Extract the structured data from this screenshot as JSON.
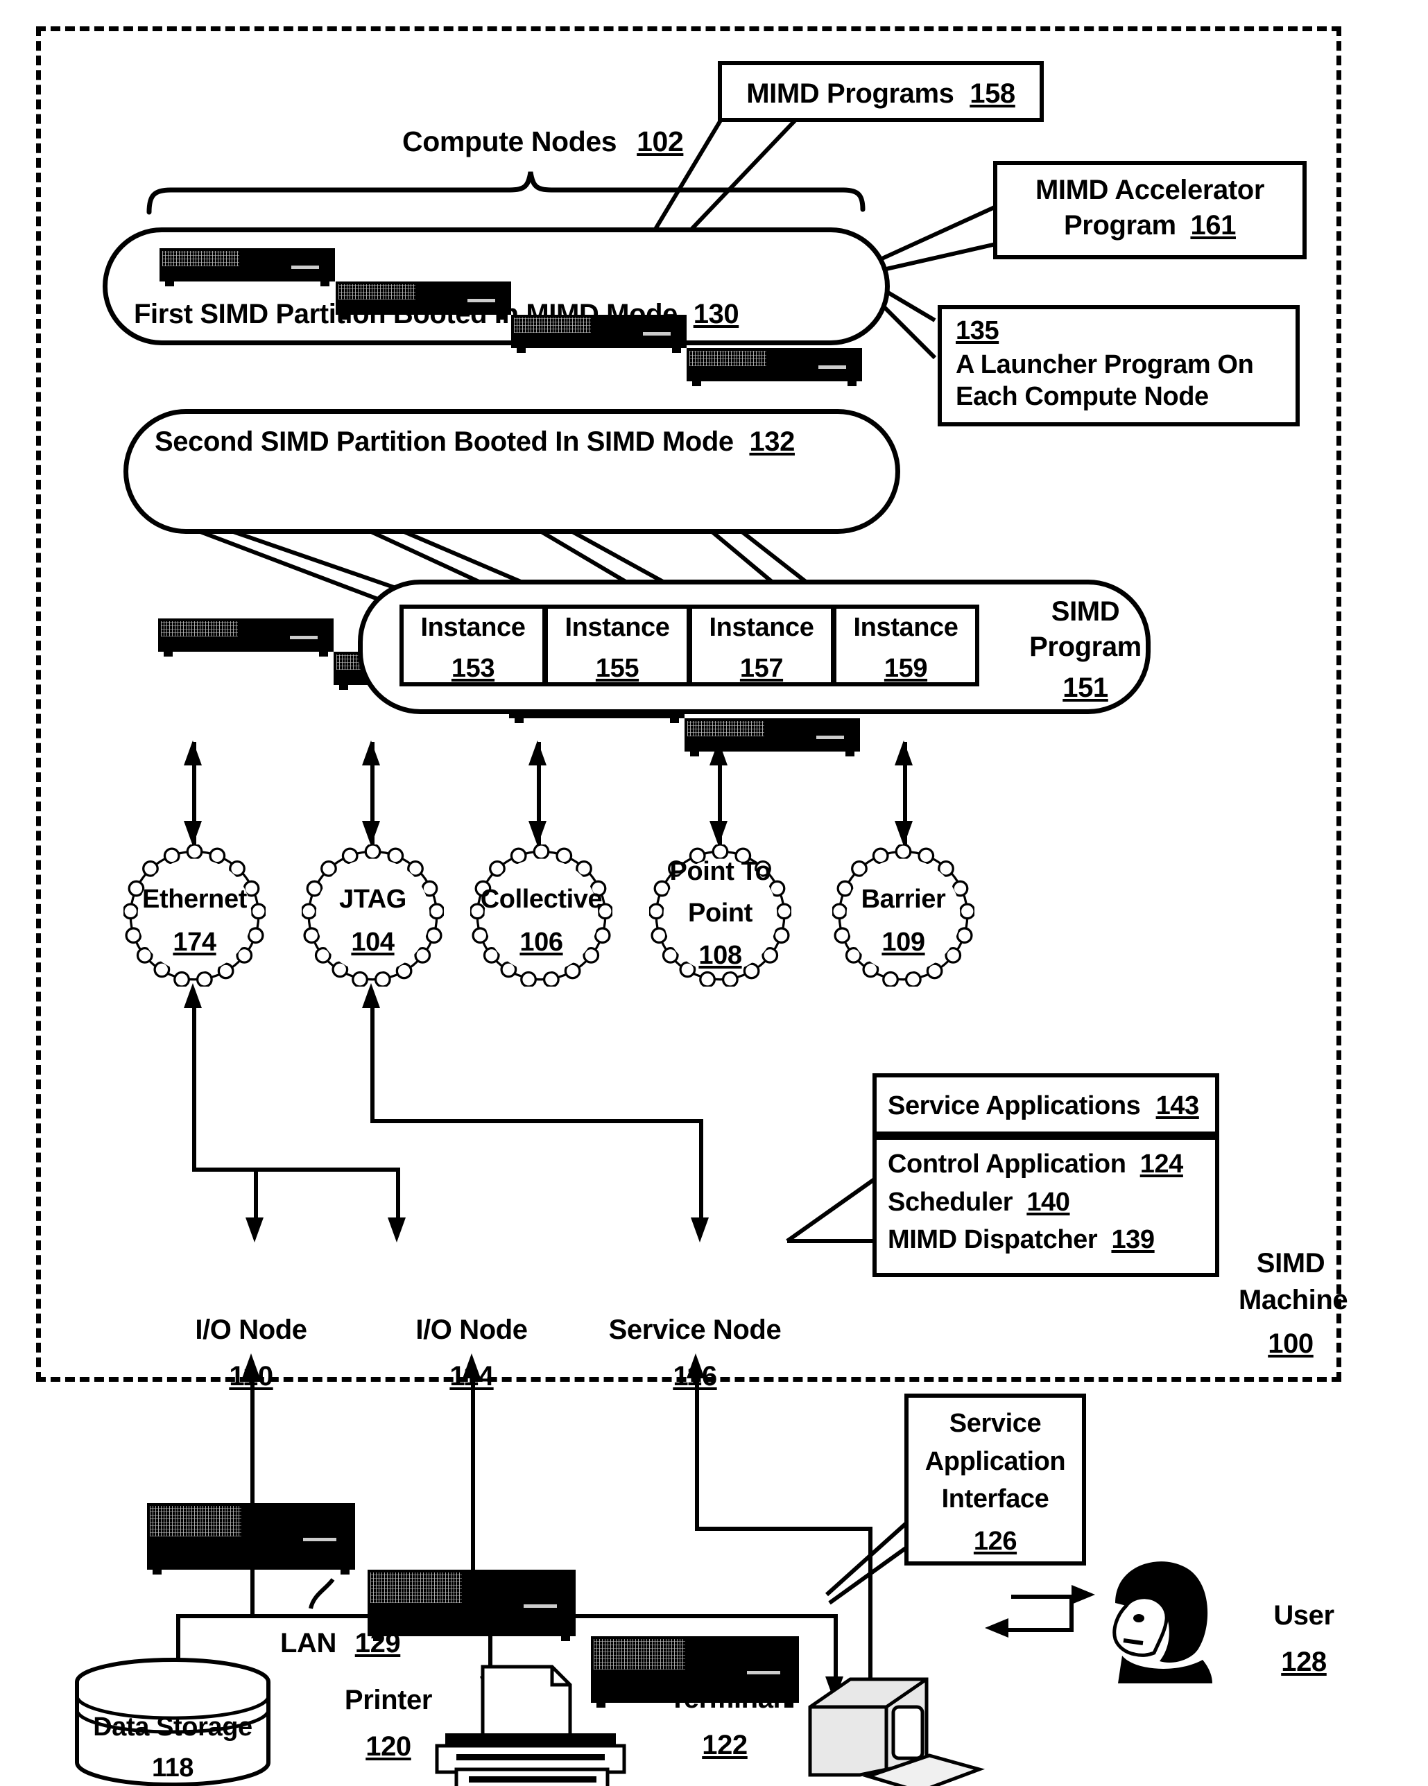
{
  "figure": {
    "machine_label_line1": "SIMD",
    "machine_label_line2": "Machine",
    "machine_ref": "100"
  },
  "compute": {
    "brace_label": "Compute Nodes",
    "brace_ref": "102",
    "first_partition": "First SIMD Partition Booted In MIMD Mode",
    "first_partition_ref": "130",
    "second_partition": "Second SIMD Partition Booted In SIMD Mode",
    "second_partition_ref": "132",
    "node_icon": "server-icon"
  },
  "callouts": {
    "mimd_programs": "MIMD Programs",
    "mimd_programs_ref": "158",
    "mimd_accel_line1": "MIMD Accelerator",
    "mimd_accel_line2": "Program",
    "mimd_accel_ref": "161",
    "launcher_ref": "135",
    "launcher_line1": "A Launcher Program On",
    "launcher_line2": "Each Compute Node"
  },
  "simd_program": {
    "title_line1": "SIMD",
    "title_line2": "Program",
    "ref": "151",
    "instances": [
      {
        "label": "Instance",
        "ref": "153"
      },
      {
        "label": "Instance",
        "ref": "155"
      },
      {
        "label": "Instance",
        "ref": "157"
      },
      {
        "label": "Instance",
        "ref": "159"
      }
    ]
  },
  "networks": [
    {
      "name": "Ethernet",
      "ref": "174",
      "two_line": false
    },
    {
      "name": "JTAG",
      "ref": "104",
      "two_line": false
    },
    {
      "name": "Collective",
      "ref": "106",
      "two_line": false
    },
    {
      "name": "Point To",
      "name2": "Point",
      "ref": "108",
      "two_line": true
    },
    {
      "name": "Barrier",
      "ref": "109",
      "two_line": false
    }
  ],
  "nodes": [
    {
      "label": "I/O Node",
      "ref": "110"
    },
    {
      "label": "I/O Node",
      "ref": "114"
    },
    {
      "label": "Service Node",
      "ref": "116"
    }
  ],
  "service_apps": {
    "header": "Service Applications",
    "header_ref": "143",
    "items": [
      {
        "label": "Control Application",
        "ref": "124"
      },
      {
        "label": "Scheduler",
        "ref": "140"
      },
      {
        "label": "MIMD Dispatcher",
        "ref": "139"
      }
    ]
  },
  "peripherals": {
    "lan_label": "LAN",
    "lan_ref": "129",
    "data_storage_line1": "Data Storage",
    "data_storage_ref": "118",
    "printer": "Printer",
    "printer_ref": "120",
    "terminal": "Terminal",
    "terminal_ref": "122",
    "user": "User",
    "user_ref": "128",
    "sai_line1": "Service",
    "sai_line2": "Application",
    "sai_line3": "Interface",
    "sai_ref": "126"
  }
}
